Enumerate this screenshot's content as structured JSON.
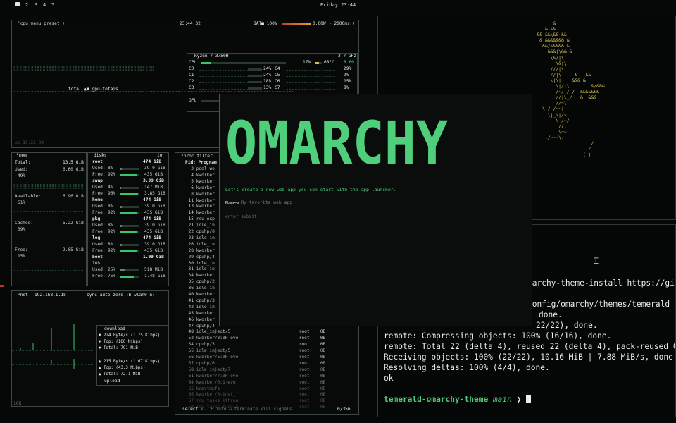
{
  "topbar": {
    "workspaces": [
      "2",
      "3",
      "4",
      "5"
    ],
    "clock": "Friday 23:44"
  },
  "cpu": {
    "tabs": "¹cpu  menu  preset +",
    "time": "23:44:32",
    "battery": "BAT■ 100%",
    "power": "0.00W",
    "interval": "- 2000ms +",
    "model": "Ryzen 7 3750H",
    "freq": "2.7 GHz",
    "total_label": "CPU",
    "total_pct": "17%",
    "temp": "68°C",
    "load": "8.60",
    "cores": [
      {
        "a": "C0",
        "ap": "24%",
        "b": "C4",
        "bp": "29%"
      },
      {
        "a": "C1",
        "ap": "24%",
        "b": "C5",
        "bp": "9%"
      },
      {
        "a": "C2",
        "ap": "18%",
        "b": "C6",
        "bp": "15%"
      },
      {
        "a": "C3",
        "ap": "13%",
        "b": "C7",
        "bp": "8%"
      }
    ],
    "gpu_label": "GPU",
    "totals": "total ▲▼ gpu-totals",
    "uptime": "up 10:22:38"
  },
  "mem": {
    "title": "²mem",
    "total_l": "Total:",
    "total_v": "13.5 GiB",
    "used_l": "Used:",
    "used_v": "6.60 GiB",
    "used_p": "49%",
    "avail_l": "Available:",
    "avail_v": "6.96 GiB",
    "avail_p": "51%",
    "cached_l": "Cached:",
    "cached_v": "5.22 GiB",
    "cached_p": "39%",
    "free_l": "Free:",
    "free_v": "2.05 GiB",
    "free_p": "15%"
  },
  "disks": {
    "title": "disks",
    "io": "io",
    "groups": [
      {
        "name": "root",
        "size": "474 GiB",
        "r1l": "Used:",
        "r1p": "8%",
        "r1v": "39.0 GiB",
        "r2l": "Free:",
        "r2p": "92%",
        "r2v": "435 GiB",
        "r1f": 0.08,
        "r2f": 0.92
      },
      {
        "name": "swap",
        "size": "3.99 GiB",
        "r1l": "Used:",
        "r1p": "4%",
        "r1v": "147 MiB",
        "r2l": "Free:",
        "r2p": "96%",
        "r2v": "3.85 GiB",
        "r1f": 0.04,
        "r2f": 0.96
      },
      {
        "name": "home",
        "size": "474 GiB",
        "r1l": "Used:",
        "r1p": "8%",
        "r1v": "39.0 GiB",
        "r2l": "Free:",
        "r2p": "92%",
        "r2v": "435 GiB",
        "r1f": 0.08,
        "r2f": 0.92
      },
      {
        "name": "pkg",
        "size": "474 GiB",
        "r1l": "Used:",
        "r1p": "8%",
        "r1v": "39.0 GiB",
        "r2l": "Free:",
        "r2p": "92%",
        "r2v": "435 GiB",
        "r1f": 0.08,
        "r2f": 0.92
      },
      {
        "name": "log",
        "size": "474 GiB",
        "r1l": "Used:",
        "r1p": "8%",
        "r1v": "39.0 GiB",
        "r2l": "Free:",
        "r2p": "92%",
        "r2v": "435 GiB",
        "r1f": 0.08,
        "r2f": 0.92
      }
    ],
    "boot": {
      "name": "boot",
      "size": "1.99 GiB",
      "io": "IO%",
      "r1l": "Used:",
      "r1p": "25%",
      "r1v": "518 MiB",
      "r2l": "Free:",
      "r2p": "75%",
      "r2v": "1.48 GiB",
      "r1f": 0.25,
      "r2f": 0.75
    }
  },
  "net": {
    "title": "³net",
    "ip": "192.168.1.18",
    "opts": "sync  auto  zero  ‹b wlan0 n›",
    "download": "download",
    "dl_rate": "▼ 224 Byte/s (1.75 Kibps)",
    "dl_top": "▼ Top:        (160 Mibps)",
    "dl_total": "▼ Total:          791 MiB",
    "ul_rate": "▲ 215 Byte/s (1.67 Kibps)",
    "ul_top": "▲ Top:        (43.3 Mibps)",
    "ul_total": "▲ Total:         72.1 MiB",
    "upload": "upload",
    "scale": "10K"
  },
  "proc": {
    "header": "⁴proc  filter",
    "cols": "Pid: Program",
    "rows": [
      {
        "pid": "3",
        "name": "pool_wo"
      },
      {
        "pid": "4",
        "name": "kworker"
      },
      {
        "pid": "5",
        "name": "kworker"
      },
      {
        "pid": "6",
        "name": "kworker"
      },
      {
        "pid": "8",
        "name": "kworker"
      },
      {
        "pid": "11",
        "name": "kworker"
      },
      {
        "pid": "13",
        "name": "kworker"
      },
      {
        "pid": "14",
        "name": "kworker"
      },
      {
        "pid": "15",
        "name": "rcu_exp"
      },
      {
        "pid": "21",
        "name": "idle_in"
      },
      {
        "pid": "22",
        "name": "cpuhp/0"
      },
      {
        "pid": "23",
        "name": "idle_in"
      },
      {
        "pid": "26",
        "name": "idle_in"
      },
      {
        "pid": "28",
        "name": "kworker"
      },
      {
        "pid": "29",
        "name": "cpuhp/4"
      },
      {
        "pid": "30",
        "name": "idle_in"
      },
      {
        "pid": "31",
        "name": "idle_in"
      },
      {
        "pid": "34",
        "name": "kworker"
      },
      {
        "pid": "35",
        "name": "cpuhp/2"
      },
      {
        "pid": "36",
        "name": "idle_in"
      },
      {
        "pid": "40",
        "name": "kworker"
      },
      {
        "pid": "41",
        "name": "cpuhp/3"
      },
      {
        "pid": "42",
        "name": "idle_in"
      },
      {
        "pid": "45",
        "name": "kworker"
      },
      {
        "pid": "46",
        "name": "kworker"
      },
      {
        "pid": "47",
        "name": "cpuhp/4"
      },
      {
        "pid": "48",
        "name": "idle_inject/5",
        "user": "root",
        "mem": "0B"
      },
      {
        "pid": "52",
        "name": "kworker/3:0H-eve",
        "user": "root",
        "mem": "0B"
      },
      {
        "pid": "54",
        "name": "cpuhp/5",
        "user": "root",
        "mem": "0B"
      },
      {
        "pid": "55",
        "name": "idle_inject/5",
        "user": "root",
        "mem": "0B"
      },
      {
        "pid": "56",
        "name": "kworker/5:0H-eve",
        "user": "root",
        "mem": "0B"
      },
      {
        "pid": "57",
        "name": "cpuhp/6",
        "user": "root",
        "mem": "0B"
      },
      {
        "pid": "58",
        "name": "idle_inject/7",
        "user": "root",
        "mem": "0B"
      },
      {
        "pid": "61",
        "name": "kworker/7:0H-eve",
        "user": "root",
        "mem": "0B"
      },
      {
        "pid": "64",
        "name": "kworker/0:1-eve",
        "user": "root",
        "mem": "0B"
      },
      {
        "pid": "65",
        "name": "kdevtmpfs",
        "user": "root",
        "mem": "0B"
      },
      {
        "pid": "66",
        "name": "kworker/R-inet_f",
        "user": "root",
        "mem": "0B"
      },
      {
        "pid": "67",
        "name": "rcu_tasks_kthrea",
        "user": "root",
        "mem": "0B"
      },
      {
        "pid": "68",
        "name": "rcu_tasks_rude_k",
        "user": "root",
        "mem": "0B"
      }
    ],
    "footer_left": "select ↓",
    "footer_hint": "↑ info ↵ terminate  kill  signals",
    "count": "0/356"
  },
  "launcher": {
    "logo": "OMARCHY",
    "prompt": "Let's create a new web app you can start with the app launcher.",
    "name_label": "Name>",
    "name_placeholder": "My favorite web app",
    "hint": "enter submit"
  },
  "terminal": {
    "lines": [
      "marchy-theme-install https://git",
      "config/omarchy/themes/temerald'.",
      "done.",
      "22/22), done.",
      "remote: Compressing objects: 100% (16/16), done.",
      "remote: Total 22 (delta 4), reused 22 (delta 4), pack-reused 0",
      "Receiving objects: 100% (22/22), 10.16 MiB | 7.88 MiB/s, done.",
      "Resolving deltas: 100% (4/4), done.",
      "ok"
    ],
    "prompt_dir": "temerald-omarchy-theme",
    "prompt_branch": "main",
    "prompt_arrow": "❯"
  },
  "colors": {
    "accent": "#4fcf7b",
    "ascii": "#d9c45d",
    "bg": "#050807"
  }
}
